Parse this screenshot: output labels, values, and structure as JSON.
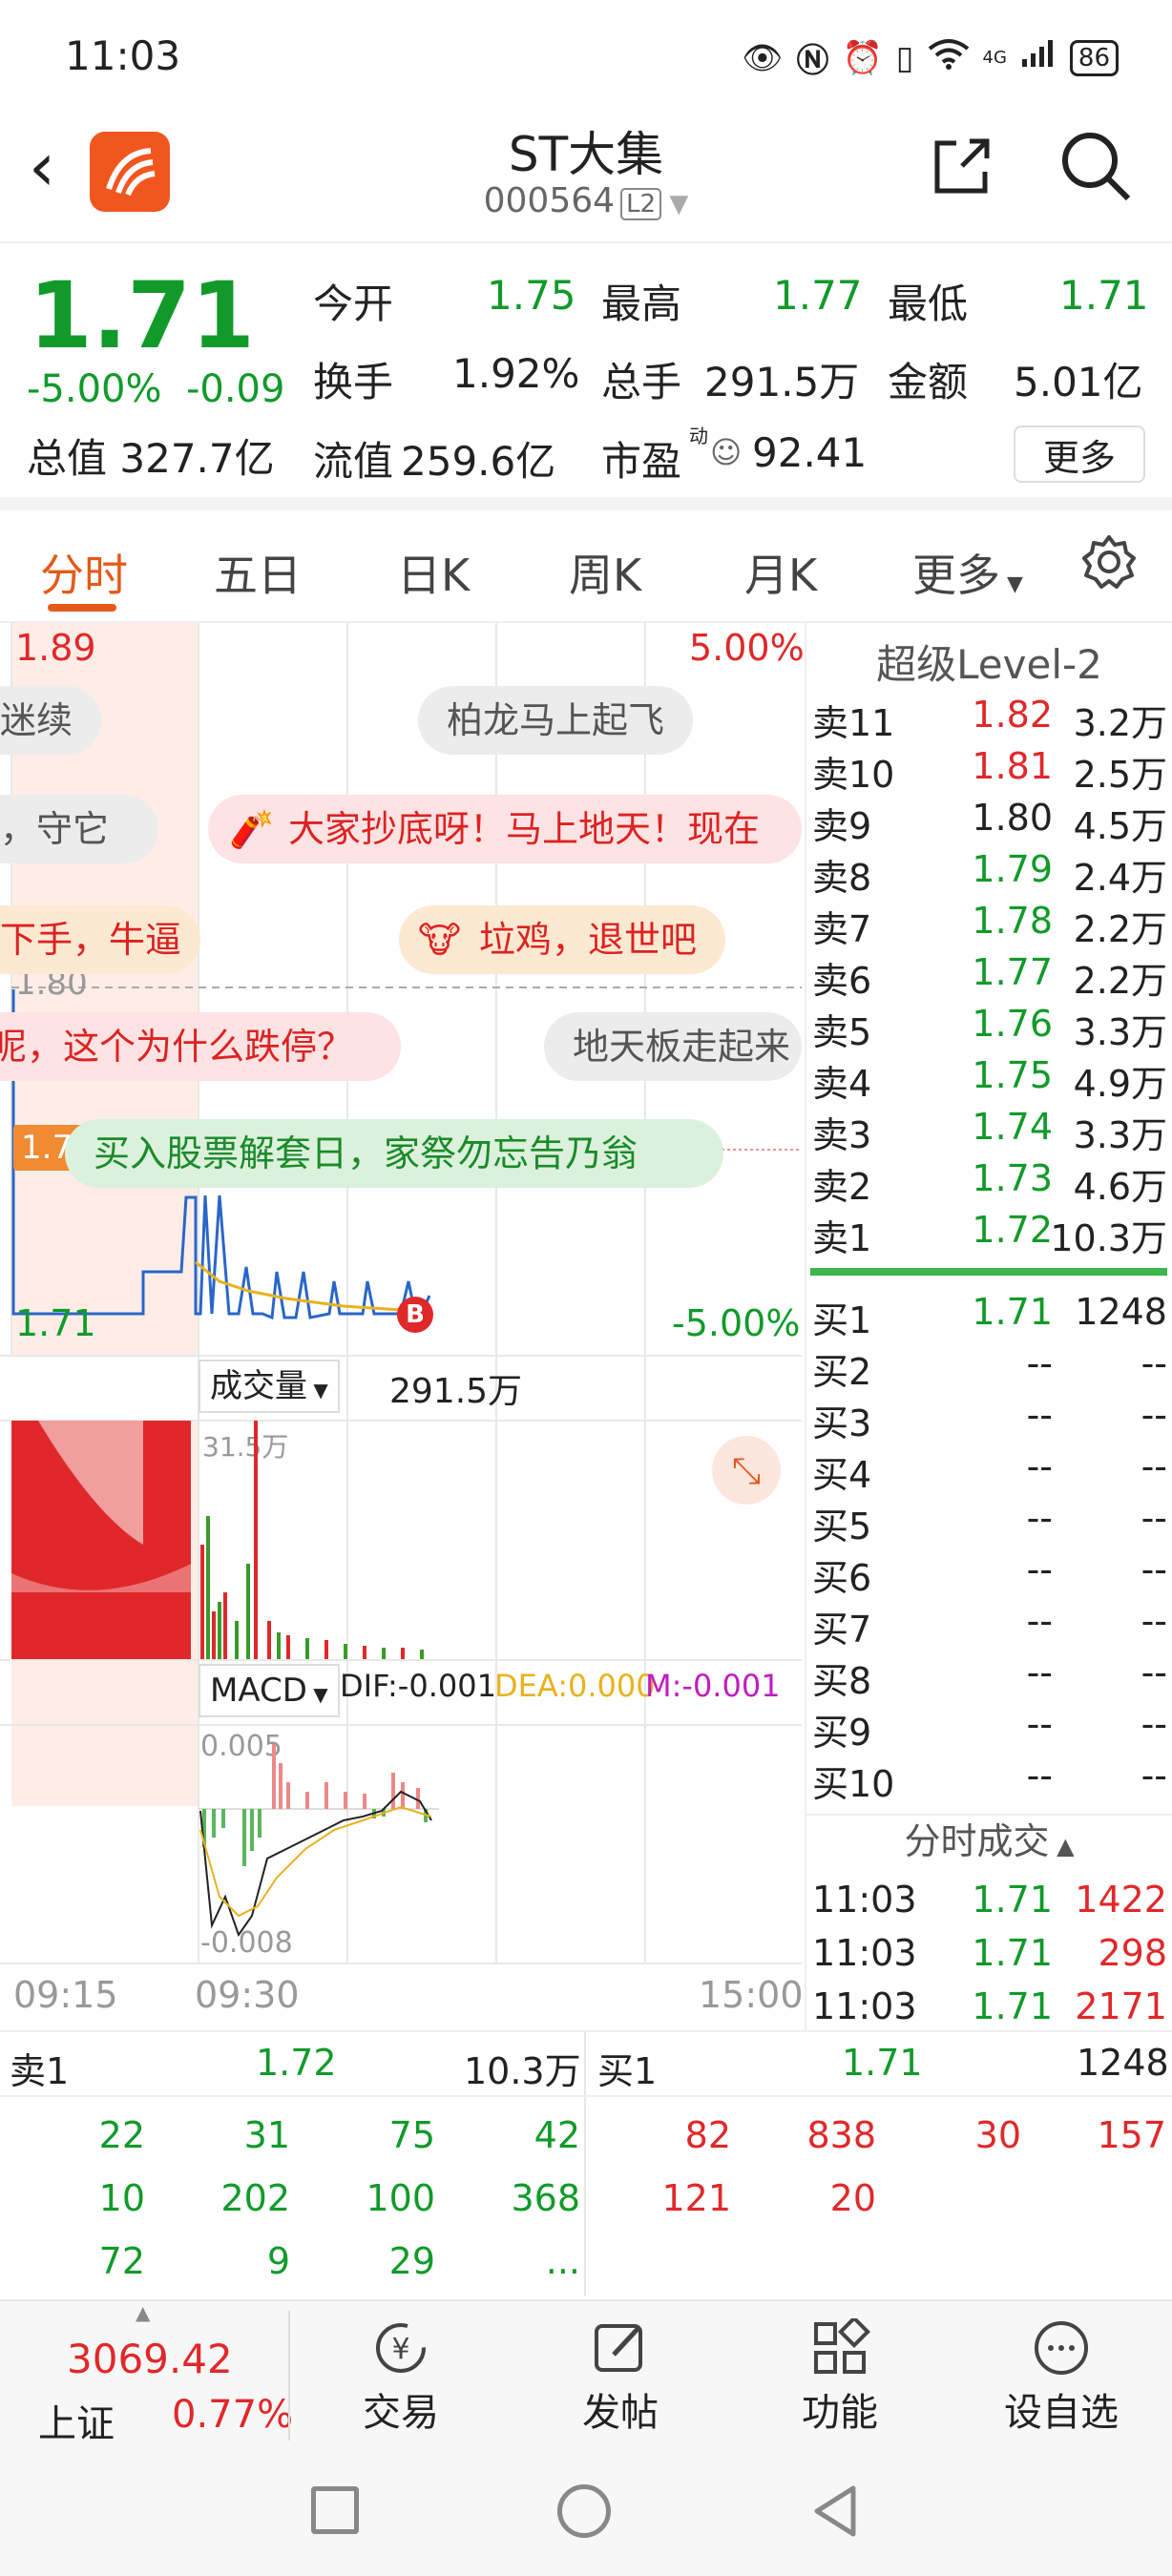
{
  "status_bar": {
    "time": "11:03",
    "network": "4G",
    "battery": "86"
  },
  "header": {
    "stock_name": "ST大集",
    "stock_code": "000564",
    "level_badge": "L2"
  },
  "quote": {
    "price": "1.71",
    "change_pct": "-5.00%",
    "change": "-0.09",
    "open_label": "今开",
    "open": "1.75",
    "high_label": "最高",
    "high": "1.77",
    "low_label": "最低",
    "low": "1.71",
    "turnover_label": "换手",
    "turnover": "1.92%",
    "volume_label": "总手",
    "volume": "291.5万",
    "amount_label": "金额",
    "amount": "5.01亿",
    "total_cap_label": "总值",
    "total_cap": "327.7亿",
    "float_cap_label": "流值",
    "float_cap": "259.6亿",
    "pe_label": "市盈",
    "pe_sup": "动",
    "pe": "92.41",
    "more_button": "更多"
  },
  "tabs": [
    "分时",
    "五日",
    "日K",
    "周K",
    "月K",
    "更多"
  ],
  "chart": {
    "top_price": "1.89",
    "top_pct": "5.00%",
    "ref_price": "1.80",
    "current_tag": "1.760",
    "bottom_price": "1.71",
    "bottom_pct": "-5.00%",
    "b_marker": "B",
    "volume_label": "成交量",
    "volume_value": "291.5万",
    "volume_max": "31.5万",
    "macd_label": "MACD",
    "dif": "DIF:-0.001",
    "dea": "DEA:0.000",
    "m": "M:-0.001",
    "macd_top": "0.005",
    "macd_bottom": "-0.008",
    "time_start": "09:15",
    "time_open": "09:30",
    "time_end": "15:00",
    "bullets": [
      "柏龙马上起飞",
      "大家抄底呀！马上地天！现在",
      "垃鸡，退世吧",
      "地天板走起来",
      "买入股票解套日，家祭勿忘告乃翁",
      "迷续",
      "，守它",
      "下手，牛逼",
      "呢，这个为什么跌停？"
    ]
  },
  "orderbook": {
    "title": "超级Level-2",
    "asks": [
      {
        "label": "卖11",
        "price": "1.82",
        "vol": "3.2万"
      },
      {
        "label": "卖10",
        "price": "1.81",
        "vol": "2.5万"
      },
      {
        "label": "卖9",
        "price": "1.80",
        "vol": "4.5万"
      },
      {
        "label": "卖8",
        "price": "1.79",
        "vol": "2.4万"
      },
      {
        "label": "卖7",
        "price": "1.78",
        "vol": "2.2万"
      },
      {
        "label": "卖6",
        "price": "1.77",
        "vol": "2.2万"
      },
      {
        "label": "卖5",
        "price": "1.76",
        "vol": "3.3万"
      },
      {
        "label": "卖4",
        "price": "1.75",
        "vol": "4.9万"
      },
      {
        "label": "卖3",
        "price": "1.74",
        "vol": "3.3万"
      },
      {
        "label": "卖2",
        "price": "1.73",
        "vol": "4.6万"
      },
      {
        "label": "卖1",
        "price": "1.72",
        "vol": "10.3万"
      }
    ],
    "bids": [
      {
        "label": "买1",
        "price": "1.71",
        "vol": "1248"
      },
      {
        "label": "买2",
        "price": "--",
        "vol": "--"
      },
      {
        "label": "买3",
        "price": "--",
        "vol": "--"
      },
      {
        "label": "买4",
        "price": "--",
        "vol": "--"
      },
      {
        "label": "买5",
        "price": "--",
        "vol": "--"
      },
      {
        "label": "买6",
        "price": "--",
        "vol": "--"
      },
      {
        "label": "买7",
        "price": "--",
        "vol": "--"
      },
      {
        "label": "买8",
        "price": "--",
        "vol": "--"
      },
      {
        "label": "买9",
        "price": "--",
        "vol": "--"
      },
      {
        "label": "买10",
        "price": "--",
        "vol": "--"
      }
    ],
    "ticks_title": "分时成交",
    "ticks": [
      {
        "time": "11:03",
        "price": "1.71",
        "vol": "1422"
      },
      {
        "time": "11:03",
        "price": "1.71",
        "vol": "298"
      },
      {
        "time": "11:03",
        "price": "1.71",
        "vol": "2171"
      }
    ]
  },
  "queue": {
    "sell_label": "卖1",
    "sell_price": "1.72",
    "sell_vol": "10.3万",
    "buy_label": "买1",
    "buy_price": "1.71",
    "buy_vol": "1248",
    "sell_orders": [
      [
        "22",
        "31",
        "75",
        "42"
      ],
      [
        "10",
        "202",
        "100",
        "368"
      ],
      [
        "72",
        "9",
        "29",
        "..."
      ]
    ],
    "buy_orders": [
      [
        "82",
        "838",
        "30",
        "157"
      ],
      [
        "121",
        "20",
        "",
        ""
      ]
    ]
  },
  "bottom_bar": {
    "index_value": "3069.42",
    "index_name": "上证",
    "index_pct": "0.77%",
    "items": [
      "交易",
      "发帖",
      "功能",
      "设自选"
    ]
  }
}
